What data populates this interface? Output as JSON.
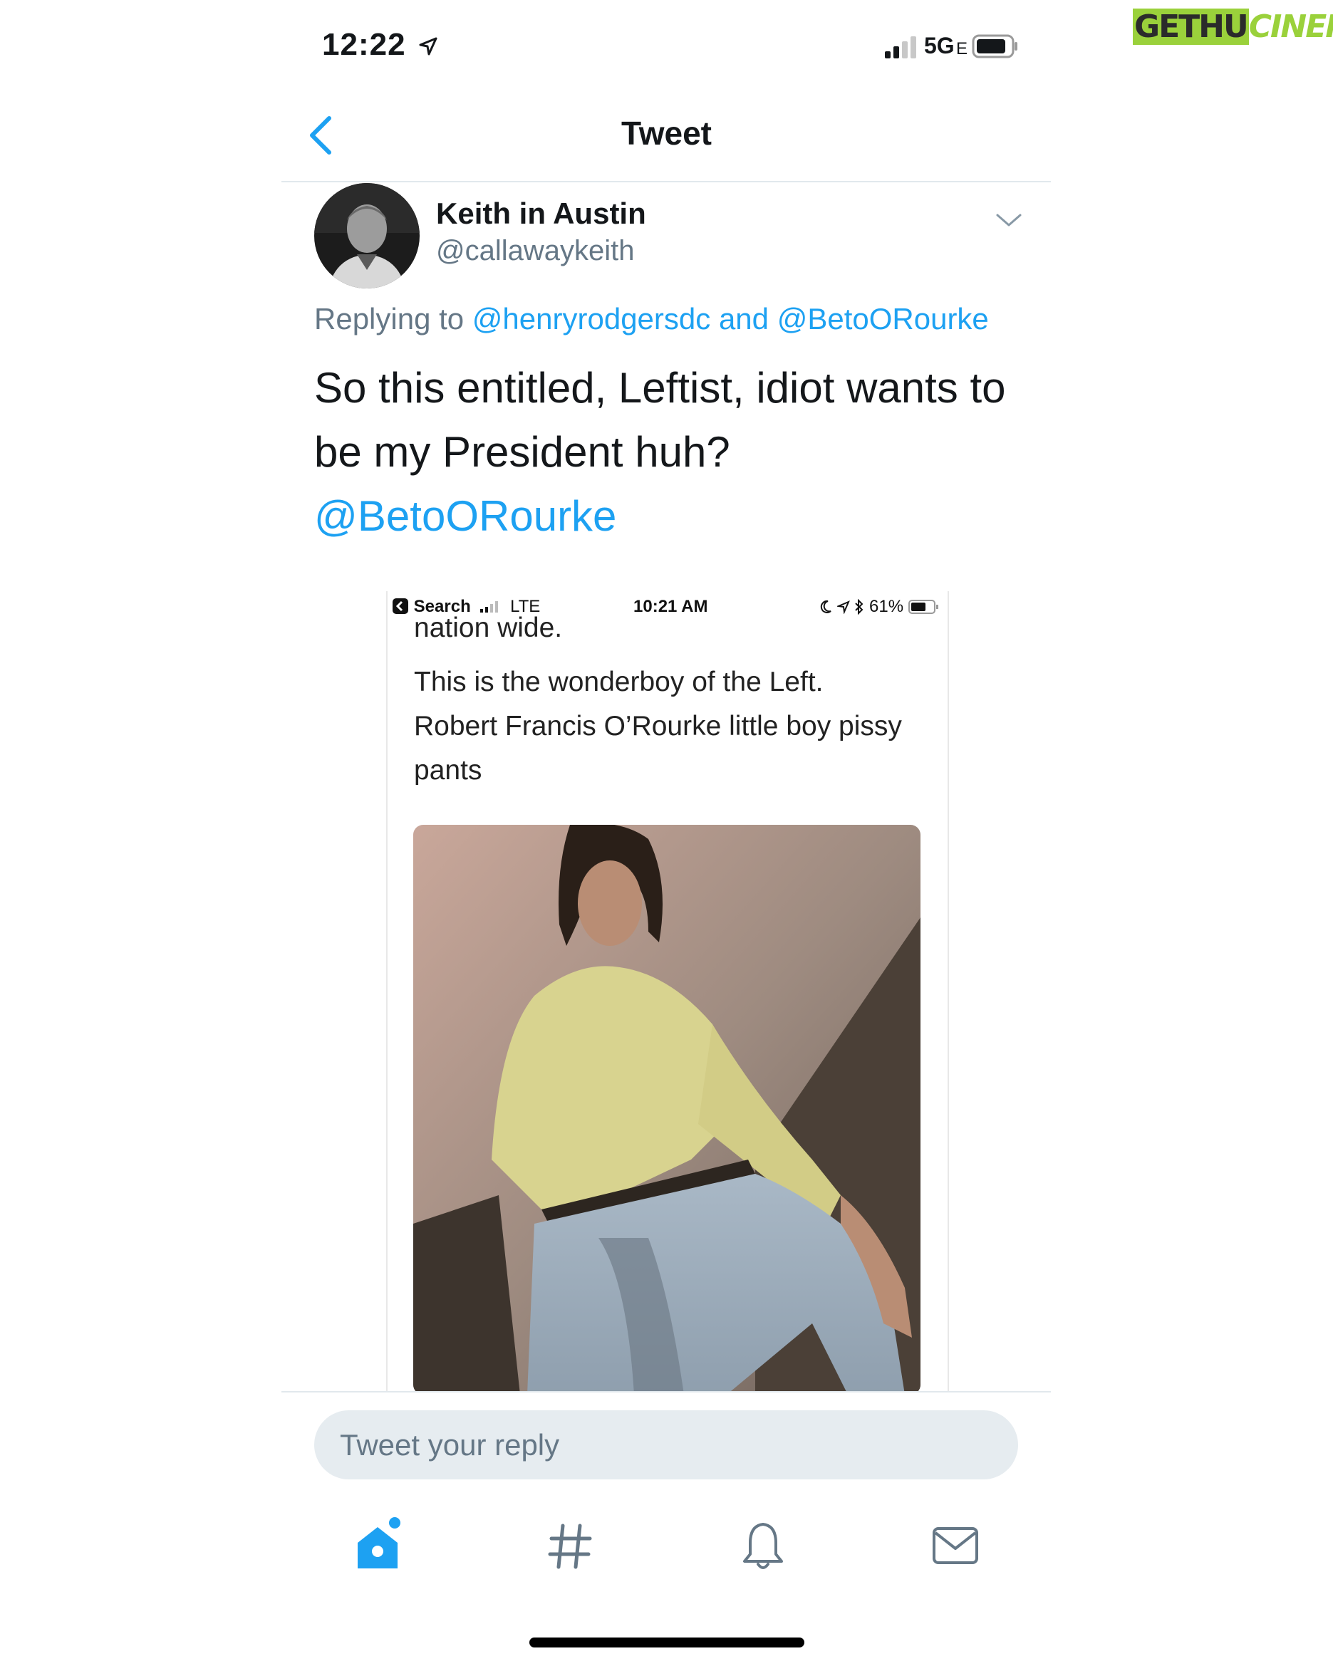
{
  "watermark": {
    "part1": "GETHU",
    "part2": "CINEMA"
  },
  "status_bar": {
    "time": "12:22",
    "network": "5G",
    "network_suffix": "E",
    "location_icon": "location-arrow-icon",
    "signal_icon": "signal-bars-icon",
    "battery_icon": "battery-icon"
  },
  "header": {
    "title": "Tweet",
    "back_icon": "chevron-left-icon"
  },
  "tweet": {
    "author_name": "Keith in Austin",
    "handle": "@callawaykeith",
    "replying_prefix": "Replying to",
    "replying_user1": "@henryrodgersdc",
    "replying_and": "and",
    "replying_user2": "@BetoORourke",
    "text_line1": "So this entitled, Leftist, idiot wants to",
    "text_line2": "be my President huh?",
    "text_mention": "@BetoORourke",
    "menu_icon": "chevron-down-icon"
  },
  "embedded": {
    "status_left": "Search",
    "status_network": "LTE",
    "status_time": "10:21 AM",
    "status_battery": "61%",
    "line0": "nation wide.",
    "line1": "This is the wonderboy of the Left.",
    "line2": "Robert Francis O’Rourke little boy pissy",
    "line3": "pants"
  },
  "reply": {
    "placeholder": "Tweet your reply"
  },
  "tabs": [
    {
      "icon": "home-icon",
      "active": true
    },
    {
      "icon": "hashtag-icon",
      "active": false
    },
    {
      "icon": "bell-icon",
      "active": false
    },
    {
      "icon": "mail-icon",
      "active": false
    }
  ],
  "colors": {
    "accent": "#1da1f2",
    "secondary_text": "#657786",
    "reply_bg": "#e6ecf0",
    "watermark": "#9ad13b"
  }
}
